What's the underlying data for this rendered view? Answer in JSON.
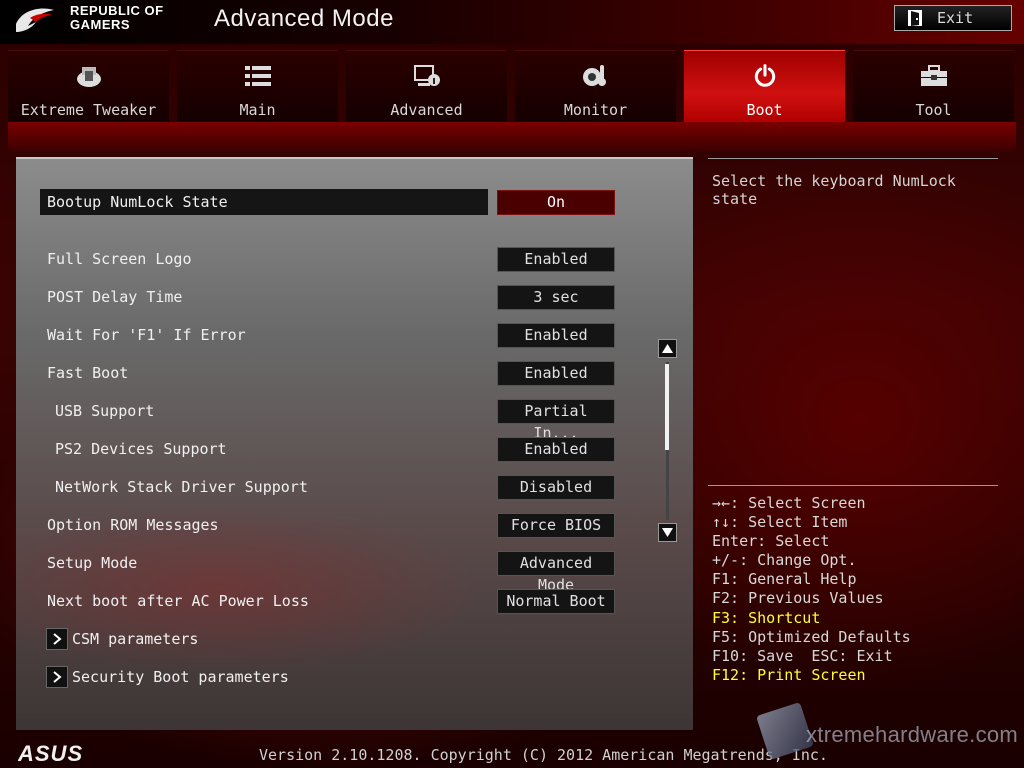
{
  "header": {
    "brand_line1": "REPUBLIC OF",
    "brand_line2": "GAMERS",
    "title": "Advanced Mode",
    "exit_label": "Exit"
  },
  "tabs": [
    {
      "label": "Extreme Tweaker",
      "icon": "tweaker-icon",
      "active": false
    },
    {
      "label": "Main",
      "icon": "list-icon",
      "active": false
    },
    {
      "label": "Advanced",
      "icon": "advanced-icon",
      "active": false
    },
    {
      "label": "Monitor",
      "icon": "thermometer-icon",
      "active": false
    },
    {
      "label": "Boot",
      "icon": "power-icon",
      "active": true
    },
    {
      "label": "Tool",
      "icon": "toolbox-icon",
      "active": false
    }
  ],
  "settings": [
    {
      "label": "Bootup NumLock State",
      "value": "On"
    },
    {
      "label": "Full Screen Logo",
      "value": "Enabled"
    },
    {
      "label": "POST Delay Time",
      "value": "3 sec"
    },
    {
      "label": "Wait For 'F1' If Error",
      "value": "Enabled"
    },
    {
      "label": "Fast Boot",
      "value": "Enabled"
    },
    {
      "label": "USB Support",
      "value": "Partial In..."
    },
    {
      "label": "PS2 Devices Support",
      "value": "Enabled"
    },
    {
      "label": "NetWork Stack Driver Support",
      "value": "Disabled"
    },
    {
      "label": "Option ROM Messages",
      "value": "Force BIOS"
    },
    {
      "label": "Setup Mode",
      "value": "Advanced Mode"
    },
    {
      "label": "Next boot after AC Power Loss",
      "value": "Normal Boot"
    }
  ],
  "submenus": [
    {
      "label": "CSM parameters"
    },
    {
      "label": "Security Boot parameters"
    }
  ],
  "help": {
    "description": "Select the keyboard NumLock state",
    "keys": [
      "→←: Select Screen",
      "↑↓: Select Item",
      "Enter: Select",
      "+/-: Change Opt.",
      "F1: General Help",
      "F2: Previous Values",
      "F3: Shortcut",
      "F5: Optimized Defaults",
      "F10: Save  ESC: Exit",
      "F12: Print Screen"
    ],
    "highlight_color": "#ffff33"
  },
  "footer": {
    "brand": "ASUS",
    "version": "Version 2.10.1208. Copyright (C) 2012 American Megatrends, Inc.",
    "watermark": "xtremehardware.com"
  },
  "colors": {
    "accent": "#d01010",
    "selected_value_bg": "#4a0000"
  }
}
